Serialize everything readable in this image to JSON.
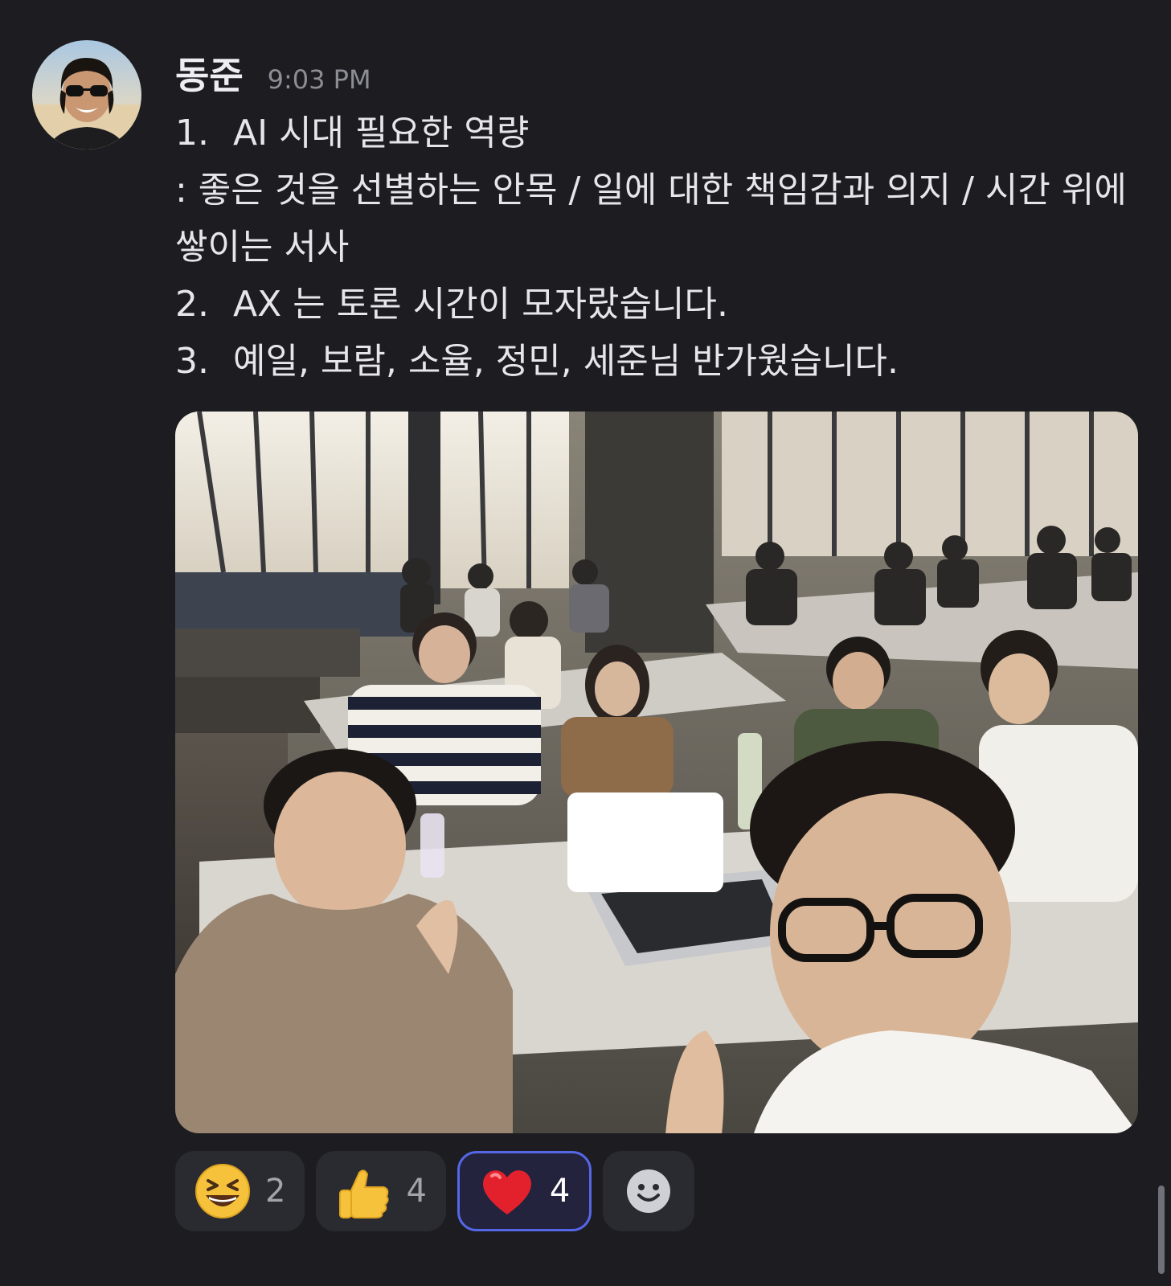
{
  "message": {
    "author": "동준",
    "time": "9:03 PM",
    "lines": [
      {
        "num": "1.",
        "text": "AI 시대 필요한 역량"
      },
      {
        "text": ": 좋은 것을 선별하는 안목 / 일에 대한 책임감과 의지 / 시간 위에 쌓이는 서사"
      },
      {
        "num": "2.",
        "text": "AX 는 토론 시간이 모자랐습니다."
      },
      {
        "num": "3.",
        "text": "예일, 보람, 소율, 정민, 세준님 반가웠습니다."
      }
    ],
    "photo": {
      "icon": "group-selfie-photo",
      "description_icon": "people-in-meeting-room"
    }
  },
  "reactions": [
    {
      "emoji": "grinning-squinting-face-icon",
      "count": "2",
      "active": false
    },
    {
      "emoji": "thumbs-up-icon",
      "count": "4",
      "active": false
    },
    {
      "emoji": "red-heart-icon",
      "count": "4",
      "active": true
    }
  ],
  "add_reaction": {
    "icon": "add-reaction-smiley-icon"
  },
  "colors": {
    "background": "#1c1c21",
    "text": "#e6e6ea",
    "muted": "#8d8d96",
    "reaction_bg": "#2a2a31",
    "active_border": "#5566e6"
  }
}
